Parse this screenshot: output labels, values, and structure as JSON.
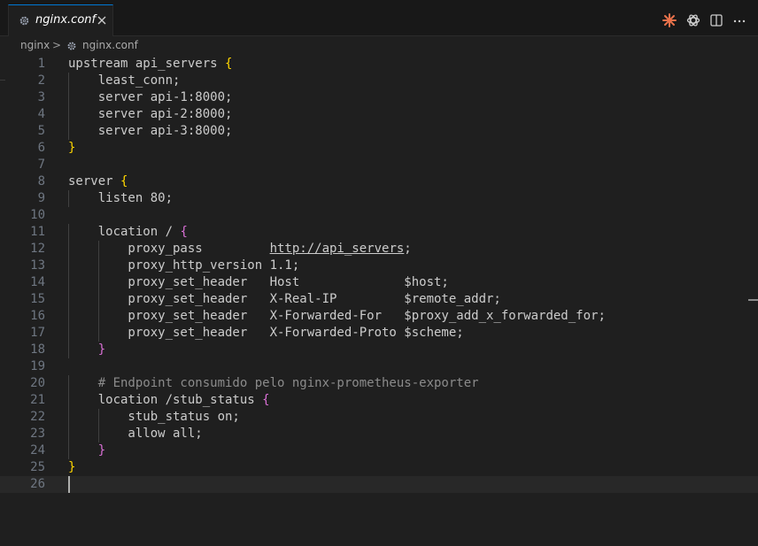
{
  "tab": {
    "label": "nginx.conf"
  },
  "breadcrumb": {
    "folder": "nginx",
    "separator": ">",
    "file": "nginx.conf"
  },
  "icons": {
    "tab_file": "gear-icon",
    "tab_close": "close-icon",
    "action_1": "sparkle-icon",
    "action_2": "openai-icon",
    "action_3": "split-editor-icon",
    "action_4": "more-icon"
  },
  "colors": {
    "accent": "#0078d4",
    "sparkle": "#e8704a",
    "brace_gold": "#ffd700",
    "brace_purple": "#da70d6"
  },
  "editor": {
    "lines": [
      {
        "n": "1",
        "text": "upstream api_servers {"
      },
      {
        "n": "2",
        "text": "    least_conn;"
      },
      {
        "n": "3",
        "text": "    server api-1:8000;"
      },
      {
        "n": "4",
        "text": "    server api-2:8000;"
      },
      {
        "n": "5",
        "text": "    server api-3:8000;"
      },
      {
        "n": "6",
        "text": "}"
      },
      {
        "n": "7",
        "text": ""
      },
      {
        "n": "8",
        "text": "server {"
      },
      {
        "n": "9",
        "text": "    listen 80;"
      },
      {
        "n": "10",
        "text": ""
      },
      {
        "n": "11",
        "text": "    location / {"
      },
      {
        "n": "12",
        "text": "        proxy_pass         http://api_servers;"
      },
      {
        "n": "13",
        "text": "        proxy_http_version 1.1;"
      },
      {
        "n": "14",
        "text": "        proxy_set_header   Host              $host;"
      },
      {
        "n": "15",
        "text": "        proxy_set_header   X-Real-IP         $remote_addr;"
      },
      {
        "n": "16",
        "text": "        proxy_set_header   X-Forwarded-For   $proxy_add_x_forwarded_for;"
      },
      {
        "n": "17",
        "text": "        proxy_set_header   X-Forwarded-Proto $scheme;"
      },
      {
        "n": "18",
        "text": "    }"
      },
      {
        "n": "19",
        "text": ""
      },
      {
        "n": "20",
        "text": "    # Endpoint consumido pelo nginx-prometheus-exporter"
      },
      {
        "n": "21",
        "text": "    location /stub_status {"
      },
      {
        "n": "22",
        "text": "        stub_status on;"
      },
      {
        "n": "23",
        "text": "        allow all;"
      },
      {
        "n": "24",
        "text": "    }"
      },
      {
        "n": "25",
        "text": "}"
      },
      {
        "n": "26",
        "text": ""
      }
    ],
    "current_line": "26"
  }
}
